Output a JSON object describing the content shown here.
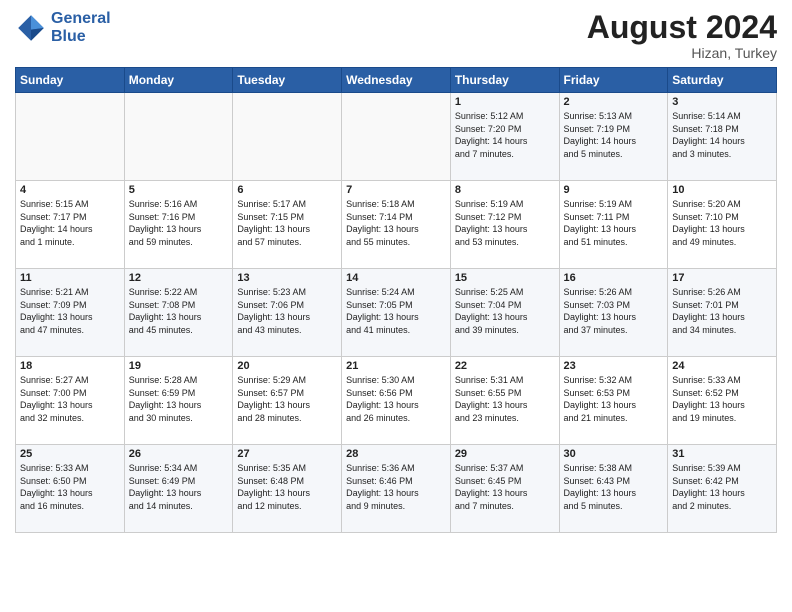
{
  "header": {
    "logo_line1": "General",
    "logo_line2": "Blue",
    "month_year": "August 2024",
    "location": "Hizan, Turkey"
  },
  "days_of_week": [
    "Sunday",
    "Monday",
    "Tuesday",
    "Wednesday",
    "Thursday",
    "Friday",
    "Saturday"
  ],
  "weeks": [
    [
      {
        "num": "",
        "info": ""
      },
      {
        "num": "",
        "info": ""
      },
      {
        "num": "",
        "info": ""
      },
      {
        "num": "",
        "info": ""
      },
      {
        "num": "1",
        "info": "Sunrise: 5:12 AM\nSunset: 7:20 PM\nDaylight: 14 hours\nand 7 minutes."
      },
      {
        "num": "2",
        "info": "Sunrise: 5:13 AM\nSunset: 7:19 PM\nDaylight: 14 hours\nand 5 minutes."
      },
      {
        "num": "3",
        "info": "Sunrise: 5:14 AM\nSunset: 7:18 PM\nDaylight: 14 hours\nand 3 minutes."
      }
    ],
    [
      {
        "num": "4",
        "info": "Sunrise: 5:15 AM\nSunset: 7:17 PM\nDaylight: 14 hours\nand 1 minute."
      },
      {
        "num": "5",
        "info": "Sunrise: 5:16 AM\nSunset: 7:16 PM\nDaylight: 13 hours\nand 59 minutes."
      },
      {
        "num": "6",
        "info": "Sunrise: 5:17 AM\nSunset: 7:15 PM\nDaylight: 13 hours\nand 57 minutes."
      },
      {
        "num": "7",
        "info": "Sunrise: 5:18 AM\nSunset: 7:14 PM\nDaylight: 13 hours\nand 55 minutes."
      },
      {
        "num": "8",
        "info": "Sunrise: 5:19 AM\nSunset: 7:12 PM\nDaylight: 13 hours\nand 53 minutes."
      },
      {
        "num": "9",
        "info": "Sunrise: 5:19 AM\nSunset: 7:11 PM\nDaylight: 13 hours\nand 51 minutes."
      },
      {
        "num": "10",
        "info": "Sunrise: 5:20 AM\nSunset: 7:10 PM\nDaylight: 13 hours\nand 49 minutes."
      }
    ],
    [
      {
        "num": "11",
        "info": "Sunrise: 5:21 AM\nSunset: 7:09 PM\nDaylight: 13 hours\nand 47 minutes."
      },
      {
        "num": "12",
        "info": "Sunrise: 5:22 AM\nSunset: 7:08 PM\nDaylight: 13 hours\nand 45 minutes."
      },
      {
        "num": "13",
        "info": "Sunrise: 5:23 AM\nSunset: 7:06 PM\nDaylight: 13 hours\nand 43 minutes."
      },
      {
        "num": "14",
        "info": "Sunrise: 5:24 AM\nSunset: 7:05 PM\nDaylight: 13 hours\nand 41 minutes."
      },
      {
        "num": "15",
        "info": "Sunrise: 5:25 AM\nSunset: 7:04 PM\nDaylight: 13 hours\nand 39 minutes."
      },
      {
        "num": "16",
        "info": "Sunrise: 5:26 AM\nSunset: 7:03 PM\nDaylight: 13 hours\nand 37 minutes."
      },
      {
        "num": "17",
        "info": "Sunrise: 5:26 AM\nSunset: 7:01 PM\nDaylight: 13 hours\nand 34 minutes."
      }
    ],
    [
      {
        "num": "18",
        "info": "Sunrise: 5:27 AM\nSunset: 7:00 PM\nDaylight: 13 hours\nand 32 minutes."
      },
      {
        "num": "19",
        "info": "Sunrise: 5:28 AM\nSunset: 6:59 PM\nDaylight: 13 hours\nand 30 minutes."
      },
      {
        "num": "20",
        "info": "Sunrise: 5:29 AM\nSunset: 6:57 PM\nDaylight: 13 hours\nand 28 minutes."
      },
      {
        "num": "21",
        "info": "Sunrise: 5:30 AM\nSunset: 6:56 PM\nDaylight: 13 hours\nand 26 minutes."
      },
      {
        "num": "22",
        "info": "Sunrise: 5:31 AM\nSunset: 6:55 PM\nDaylight: 13 hours\nand 23 minutes."
      },
      {
        "num": "23",
        "info": "Sunrise: 5:32 AM\nSunset: 6:53 PM\nDaylight: 13 hours\nand 21 minutes."
      },
      {
        "num": "24",
        "info": "Sunrise: 5:33 AM\nSunset: 6:52 PM\nDaylight: 13 hours\nand 19 minutes."
      }
    ],
    [
      {
        "num": "25",
        "info": "Sunrise: 5:33 AM\nSunset: 6:50 PM\nDaylight: 13 hours\nand 16 minutes."
      },
      {
        "num": "26",
        "info": "Sunrise: 5:34 AM\nSunset: 6:49 PM\nDaylight: 13 hours\nand 14 minutes."
      },
      {
        "num": "27",
        "info": "Sunrise: 5:35 AM\nSunset: 6:48 PM\nDaylight: 13 hours\nand 12 minutes."
      },
      {
        "num": "28",
        "info": "Sunrise: 5:36 AM\nSunset: 6:46 PM\nDaylight: 13 hours\nand 9 minutes."
      },
      {
        "num": "29",
        "info": "Sunrise: 5:37 AM\nSunset: 6:45 PM\nDaylight: 13 hours\nand 7 minutes."
      },
      {
        "num": "30",
        "info": "Sunrise: 5:38 AM\nSunset: 6:43 PM\nDaylight: 13 hours\nand 5 minutes."
      },
      {
        "num": "31",
        "info": "Sunrise: 5:39 AM\nSunset: 6:42 PM\nDaylight: 13 hours\nand 2 minutes."
      }
    ]
  ]
}
